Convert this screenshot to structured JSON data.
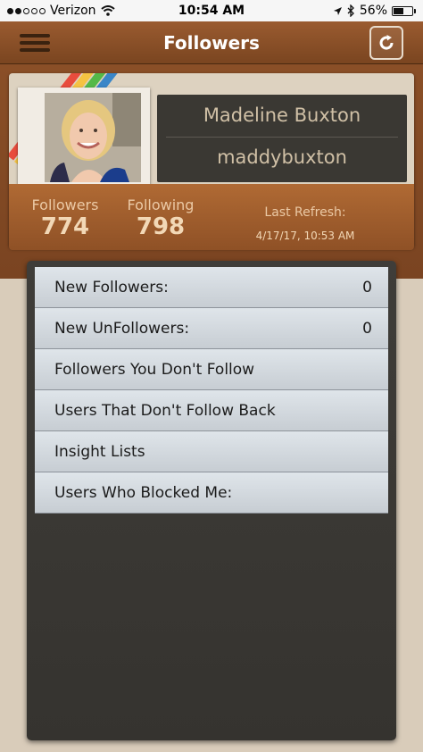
{
  "status_bar": {
    "carrier": "Verizon",
    "time": "10:54 AM",
    "battery": "56%",
    "battery_level": 0.56,
    "icons": [
      "wifi-icon",
      "location-arrow-icon",
      "bluetooth-icon",
      "battery-icon"
    ]
  },
  "nav": {
    "title": "Followers",
    "left_icon": "menu-icon",
    "right_icon": "refresh-icon"
  },
  "profile": {
    "full_name": "Madeline Buxton",
    "username": "maddybuxton"
  },
  "stats": {
    "followers_label": "Followers",
    "followers_value": "774",
    "following_label": "Following",
    "following_value": "798",
    "last_refresh_label": "Last Refresh:",
    "last_refresh_value": "4/17/17, 10:53 AM"
  },
  "menu": {
    "items": [
      {
        "label": "New Followers:",
        "count": "0"
      },
      {
        "label": "New UnFollowers:",
        "count": "0"
      },
      {
        "label": "Followers You Don't Follow",
        "count": ""
      },
      {
        "label": "Users That Don't Follow Back",
        "count": ""
      },
      {
        "label": "Insight Lists",
        "count": ""
      },
      {
        "label": "Users Who Blocked Me:",
        "count": ""
      }
    ]
  },
  "colors": {
    "header_brown": "#8a4f27",
    "panel_dark": "#3a3833",
    "list_item": "#d3d9de",
    "ribbon": [
      "#e84c3d",
      "#f5c342",
      "#54b948",
      "#3a86c8"
    ]
  }
}
